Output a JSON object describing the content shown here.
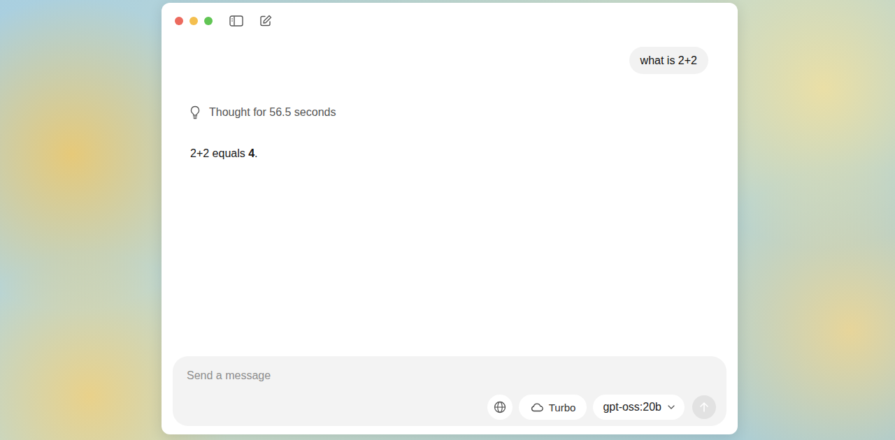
{
  "messages": [
    {
      "role": "user",
      "text": "what is 2+2"
    }
  ],
  "thinking": {
    "label": "Thought for 56.5 seconds"
  },
  "answer": {
    "before": "2+2 equals ",
    "bold": "4",
    "after": "."
  },
  "composer": {
    "placeholder": "Send a message",
    "turbo": {
      "label": "Turbo",
      "selected": false
    },
    "model": {
      "label": "gpt-oss:20b"
    },
    "send": {
      "disabled": true
    }
  }
}
